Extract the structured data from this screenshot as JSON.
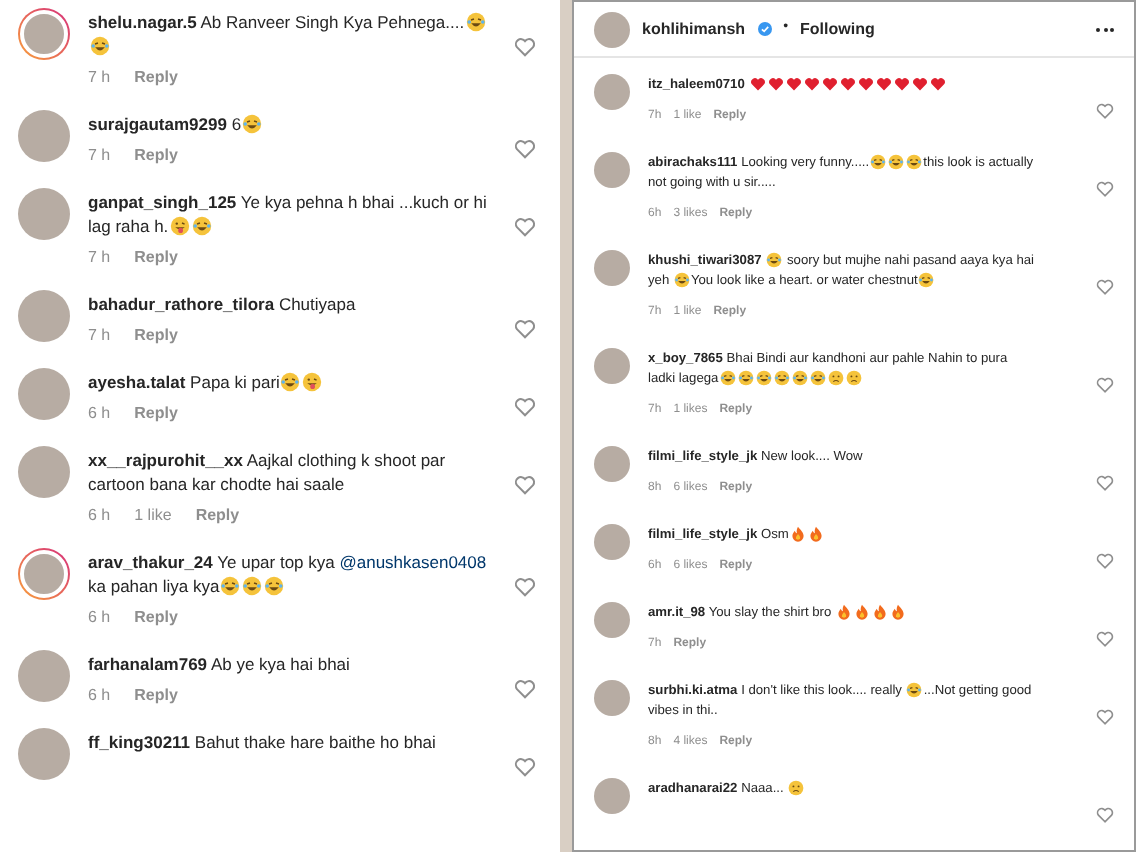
{
  "left_comments": [
    {
      "user": "shelu.nagar.5",
      "story_ring": true,
      "parts": [
        {
          "kind": "text",
          "text": "Ab Ranveer Singh Kya Pehnega...."
        },
        {
          "kind": "emoji_laugh"
        },
        {
          "kind": "emoji_laugh"
        }
      ],
      "time": "7 h",
      "reply": "Reply"
    },
    {
      "user": "surajgautam9299",
      "story_ring": false,
      "parts": [
        {
          "kind": "text",
          "text": "6"
        },
        {
          "kind": "emoji_laugh"
        }
      ],
      "time": "7 h",
      "reply": "Reply"
    },
    {
      "user": "ganpat_singh_125",
      "story_ring": false,
      "parts": [
        {
          "kind": "text",
          "text": "Ye kya pehna h bhai ...kuch or hi lag raha h."
        },
        {
          "kind": "emoji_tongue"
        },
        {
          "kind": "emoji_laugh"
        }
      ],
      "time": "7 h",
      "reply": "Reply"
    },
    {
      "user": "bahadur_rathore_tilora",
      "story_ring": false,
      "parts": [
        {
          "kind": "text",
          "text": "Chutiyapa"
        }
      ],
      "time": "7 h",
      "reply": "Reply"
    },
    {
      "user": "ayesha.talat",
      "story_ring": false,
      "parts": [
        {
          "kind": "text",
          "text": "Papa ki pari"
        },
        {
          "kind": "emoji_laugh"
        },
        {
          "kind": "emoji_tongue"
        }
      ],
      "time": "6 h",
      "reply": "Reply"
    },
    {
      "user": "xx__rajpurohit__xx",
      "story_ring": false,
      "parts": [
        {
          "kind": "text",
          "text": "Aajkal clothing k shoot par cartoon bana kar chodte hai saale"
        }
      ],
      "time": "6 h",
      "likes": "1 like",
      "reply": "Reply"
    },
    {
      "user": "arav_thakur_24",
      "story_ring": true,
      "parts": [
        {
          "kind": "text",
          "text": "Ye upar top kya "
        },
        {
          "kind": "mention",
          "text": "@anushkasen0408"
        },
        {
          "kind": "text",
          "text": "  ka pahan liya kya"
        },
        {
          "kind": "emoji_laugh"
        },
        {
          "kind": "emoji_laugh"
        },
        {
          "kind": "emoji_laugh"
        }
      ],
      "time": "6 h",
      "reply": "Reply"
    },
    {
      "user": "farhanalam769",
      "story_ring": false,
      "parts": [
        {
          "kind": "text",
          "text": "Ab ye kya hai bhai"
        }
      ],
      "time": "6 h",
      "reply": "Reply"
    },
    {
      "user": "ff_king30211",
      "story_ring": false,
      "parts": [
        {
          "kind": "text",
          "text": "Bahut thake hare baithe ho bhai"
        }
      ]
    }
  ],
  "right_header": {
    "user": "kohlihimansh",
    "verified": true,
    "separator": "•",
    "following": "Following"
  },
  "right_comments": [
    {
      "user": "itz_haleem0710",
      "parts": [
        {
          "kind": "emoji_heart"
        },
        {
          "kind": "emoji_heart"
        },
        {
          "kind": "emoji_heart"
        },
        {
          "kind": "emoji_heart"
        },
        {
          "kind": "emoji_heart"
        },
        {
          "kind": "emoji_heart"
        },
        {
          "kind": "emoji_heart"
        },
        {
          "kind": "emoji_heart"
        },
        {
          "kind": "emoji_heart"
        },
        {
          "kind": "emoji_heart"
        },
        {
          "kind": "emoji_heart"
        }
      ],
      "time": "7h",
      "likes": "1 like",
      "reply": "Reply"
    },
    {
      "user": "abirachaks111",
      "parts": [
        {
          "kind": "text",
          "text": "Looking very funny....."
        },
        {
          "kind": "emoji_laugh"
        },
        {
          "kind": "emoji_laugh"
        },
        {
          "kind": "emoji_laugh"
        },
        {
          "kind": "text",
          "text": "this look is actually not going with u sir....."
        }
      ],
      "time": "6h",
      "likes": "3 likes",
      "reply": "Reply"
    },
    {
      "user": "khushi_tiwari3087",
      "parts": [
        {
          "kind": "emoji_laugh"
        },
        {
          "kind": "text",
          "text": " soory but mujhe nahi pasand aaya kya hai yeh "
        },
        {
          "kind": "emoji_laugh"
        },
        {
          "kind": "text",
          "text": "You look like a heart. or water chestnut"
        },
        {
          "kind": "emoji_laugh"
        }
      ],
      "time": "7h",
      "likes": "1 like",
      "reply": "Reply"
    },
    {
      "user": "x_boy_7865",
      "parts": [
        {
          "kind": "text",
          "text": "Bhai Bindi aur kandhoni aur pahle Nahin to pura ladki lagega"
        },
        {
          "kind": "emoji_laugh"
        },
        {
          "kind": "emoji_laugh"
        },
        {
          "kind": "emoji_laugh"
        },
        {
          "kind": "emoji_laugh"
        },
        {
          "kind": "emoji_laugh"
        },
        {
          "kind": "emoji_laugh"
        },
        {
          "kind": "emoji_sad"
        },
        {
          "kind": "emoji_sad"
        }
      ],
      "time": "7h",
      "likes": "1 likes",
      "reply": "Reply"
    },
    {
      "user": "filmi_life_style_jk",
      "parts": [
        {
          "kind": "text",
          "text": "New look.... Wow"
        }
      ],
      "time": "8h",
      "likes": "6 likes",
      "reply": "Reply"
    },
    {
      "user": "filmi_life_style_jk",
      "parts": [
        {
          "kind": "text",
          "text": "Osm"
        },
        {
          "kind": "emoji_fire"
        },
        {
          "kind": "emoji_fire"
        }
      ],
      "time": "6h",
      "likes": "6 likes",
      "reply": "Reply"
    },
    {
      "user": "amr.it_98",
      "parts": [
        {
          "kind": "text",
          "text": "You slay the shirt bro "
        },
        {
          "kind": "emoji_fire"
        },
        {
          "kind": "emoji_fire"
        },
        {
          "kind": "emoji_fire"
        },
        {
          "kind": "emoji_fire"
        }
      ],
      "time": "7h",
      "reply": "Reply"
    },
    {
      "user": "surbhi.ki.atma",
      "parts": [
        {
          "kind": "text",
          "text": "I don't like this look.... really "
        },
        {
          "kind": "emoji_laugh"
        },
        {
          "kind": "text",
          "text": "...Not getting good vibes in thi.."
        }
      ],
      "time": "8h",
      "likes": "4 likes",
      "reply": "Reply"
    },
    {
      "user": "aradhanarai22",
      "parts": [
        {
          "kind": "text",
          "text": "Naaa... "
        },
        {
          "kind": "emoji_sad"
        }
      ]
    }
  ]
}
